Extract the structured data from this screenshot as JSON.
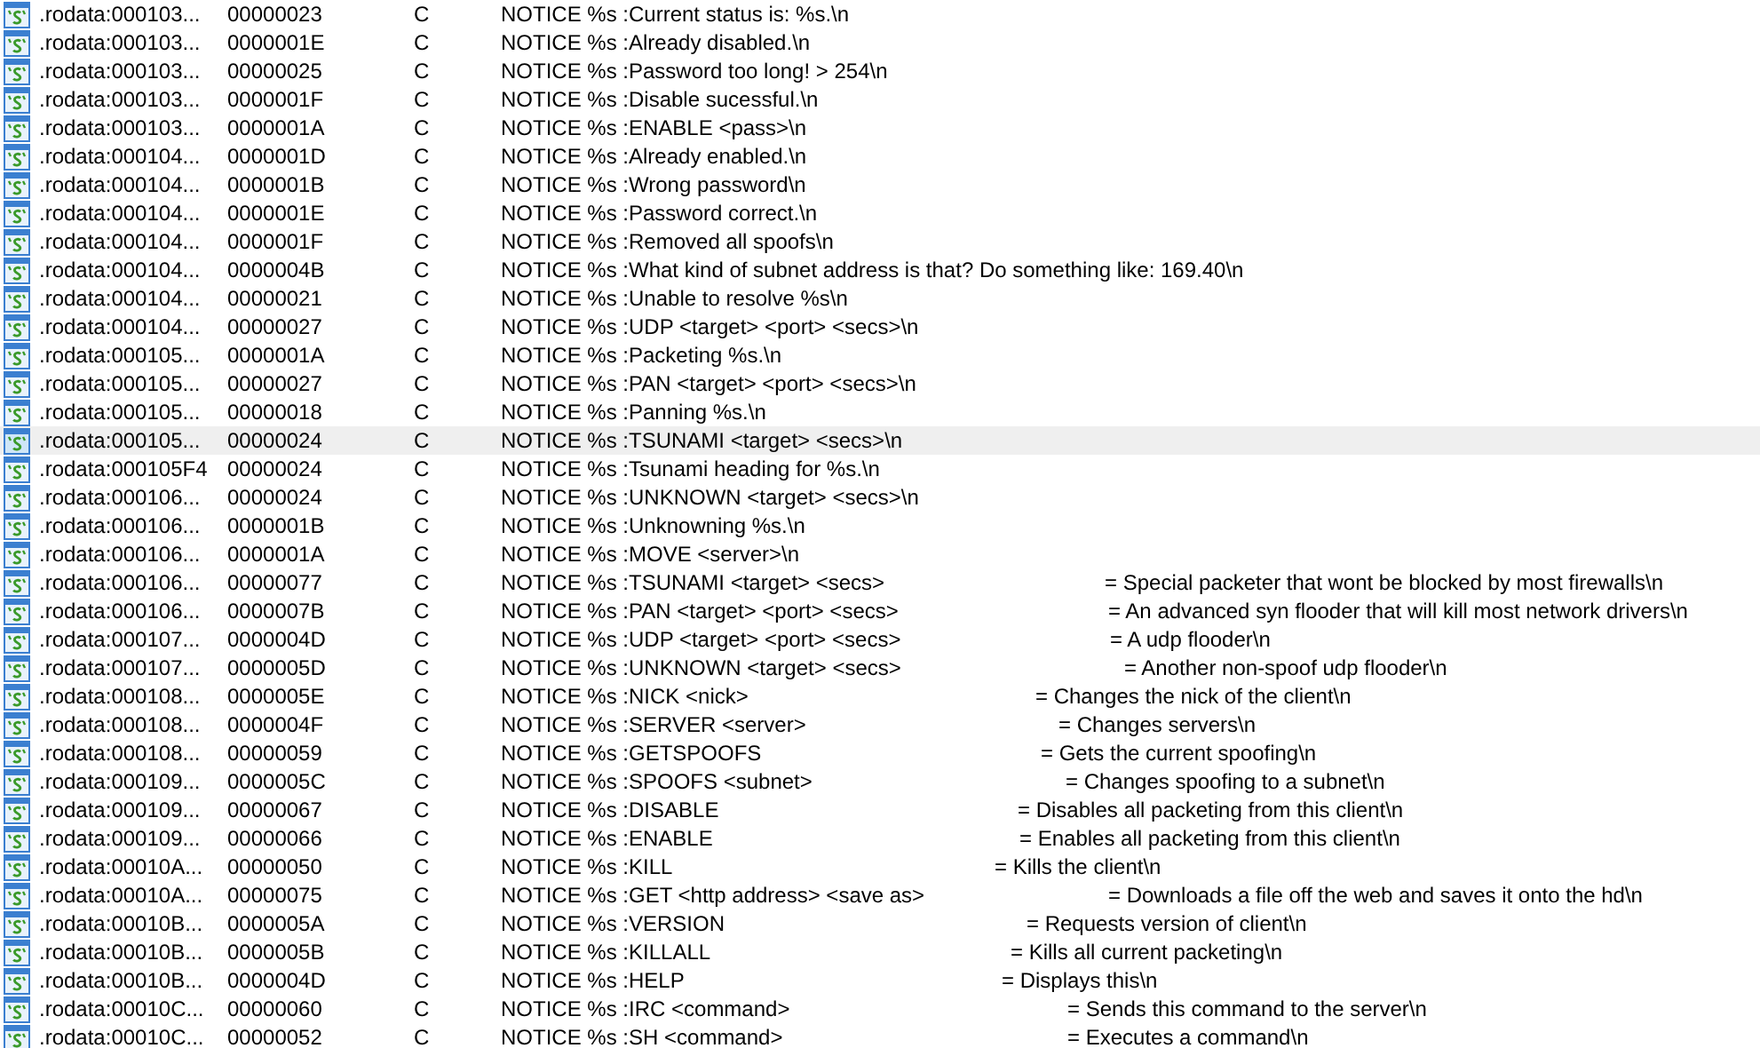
{
  "strings": [
    {
      "address": ".rodata:000103...",
      "length": "00000023",
      "type": "C",
      "string": "NOTICE %s :Current status is: %s.\\n",
      "selected": false
    },
    {
      "address": ".rodata:000103...",
      "length": "0000001E",
      "type": "C",
      "string": "NOTICE %s :Already disabled.\\n",
      "selected": false
    },
    {
      "address": ".rodata:000103...",
      "length": "00000025",
      "type": "C",
      "string": "NOTICE %s :Password too long! > 254\\n",
      "selected": false
    },
    {
      "address": ".rodata:000103...",
      "length": "0000001F",
      "type": "C",
      "string": "NOTICE %s :Disable sucessful.\\n",
      "selected": false
    },
    {
      "address": ".rodata:000103...",
      "length": "0000001A",
      "type": "C",
      "string": "NOTICE %s :ENABLE <pass>\\n",
      "selected": false
    },
    {
      "address": ".rodata:000104...",
      "length": "0000001D",
      "type": "C",
      "string": "NOTICE %s :Already enabled.\\n",
      "selected": false
    },
    {
      "address": ".rodata:000104...",
      "length": "0000001B",
      "type": "C",
      "string": "NOTICE %s :Wrong password\\n",
      "selected": false
    },
    {
      "address": ".rodata:000104...",
      "length": "0000001E",
      "type": "C",
      "string": "NOTICE %s :Password correct.\\n",
      "selected": false
    },
    {
      "address": ".rodata:000104...",
      "length": "0000001F",
      "type": "C",
      "string": "NOTICE %s :Removed all spoofs\\n",
      "selected": false
    },
    {
      "address": ".rodata:000104...",
      "length": "0000004B",
      "type": "C",
      "string": "NOTICE %s :What kind of subnet address is that? Do something like: 169.40\\n",
      "selected": false
    },
    {
      "address": ".rodata:000104...",
      "length": "00000021",
      "type": "C",
      "string": "NOTICE %s :Unable to resolve %s\\n",
      "selected": false
    },
    {
      "address": ".rodata:000104...",
      "length": "00000027",
      "type": "C",
      "string": "NOTICE %s :UDP <target> <port> <secs>\\n",
      "selected": false
    },
    {
      "address": ".rodata:000105...",
      "length": "0000001A",
      "type": "C",
      "string": "NOTICE %s :Packeting %s.\\n",
      "selected": false
    },
    {
      "address": ".rodata:000105...",
      "length": "00000027",
      "type": "C",
      "string": "NOTICE %s :PAN <target> <port> <secs>\\n",
      "selected": false
    },
    {
      "address": ".rodata:000105...",
      "length": "00000018",
      "type": "C",
      "string": "NOTICE %s :Panning %s.\\n",
      "selected": false
    },
    {
      "address": ".rodata:000105...",
      "length": "00000024",
      "type": "C",
      "string": "NOTICE %s :TSUNAMI <target> <secs>\\n",
      "selected": true
    },
    {
      "address": ".rodata:000105F4",
      "length": "00000024",
      "type": "C",
      "string": "NOTICE %s :Tsunami heading for %s.\\n",
      "selected": false
    },
    {
      "address": ".rodata:000106...",
      "length": "00000024",
      "type": "C",
      "string": "NOTICE %s :UNKNOWN <target> <secs>\\n",
      "selected": false
    },
    {
      "address": ".rodata:000106...",
      "length": "0000001B",
      "type": "C",
      "string": "NOTICE %s :Unknowning %s.\\n",
      "selected": false
    },
    {
      "address": ".rodata:000106...",
      "length": "0000001A",
      "type": "C",
      "string": "NOTICE %s :MOVE <server>\\n",
      "selected": false
    },
    {
      "address": ".rodata:000106...",
      "length": "00000077",
      "type": "C",
      "string": "NOTICE %s :TSUNAMI <target> <secs>",
      "help": "= Special packeter that wont be blocked by most firewalls\\n",
      "selected": false
    },
    {
      "address": ".rodata:000106...",
      "length": "0000007B",
      "type": "C",
      "string": "NOTICE %s :PAN <target> <port> <secs>",
      "help": "= An advanced syn flooder that will kill most network drivers\\n",
      "selected": false
    },
    {
      "address": ".rodata:000107...",
      "length": "0000004D",
      "type": "C",
      "string": "NOTICE %s :UDP <target> <port> <secs>",
      "help": "= A udp flooder\\n",
      "selected": false
    },
    {
      "address": ".rodata:000107...",
      "length": "0000005D",
      "type": "C",
      "string": "NOTICE %s :UNKNOWN <target> <secs>",
      "help": "= Another non-spoof udp flooder\\n",
      "selected": false
    },
    {
      "address": ".rodata:000108...",
      "length": "0000005E",
      "type": "C",
      "string": "NOTICE %s :NICK <nick>",
      "help": "= Changes the nick of the client\\n",
      "selected": false
    },
    {
      "address": ".rodata:000108...",
      "length": "0000004F",
      "type": "C",
      "string": "NOTICE %s :SERVER <server>",
      "help": "= Changes servers\\n",
      "selected": false
    },
    {
      "address": ".rodata:000108...",
      "length": "00000059",
      "type": "C",
      "string": "NOTICE %s :GETSPOOFS",
      "help": "= Gets the current spoofing\\n",
      "selected": false
    },
    {
      "address": ".rodata:000109...",
      "length": "0000005C",
      "type": "C",
      "string": "NOTICE %s :SPOOFS <subnet>",
      "help": "= Changes spoofing to a subnet\\n",
      "selected": false
    },
    {
      "address": ".rodata:000109...",
      "length": "00000067",
      "type": "C",
      "string": "NOTICE %s :DISABLE",
      "help": "= Disables all packeting from this client\\n",
      "selected": false
    },
    {
      "address": ".rodata:000109...",
      "length": "00000066",
      "type": "C",
      "string": "NOTICE %s :ENABLE",
      "help": "= Enables all packeting from this client\\n",
      "selected": false
    },
    {
      "address": ".rodata:00010A...",
      "length": "00000050",
      "type": "C",
      "string": "NOTICE %s :KILL",
      "help": "= Kills the client\\n",
      "selected": false
    },
    {
      "address": ".rodata:00010A...",
      "length": "00000075",
      "type": "C",
      "string": "NOTICE %s :GET <http address> <save as>",
      "help": "= Downloads a file off the web and saves it onto the hd\\n",
      "selected": false
    },
    {
      "address": ".rodata:00010B...",
      "length": "0000005A",
      "type": "C",
      "string": "NOTICE %s :VERSION",
      "help": "= Requests version of client\\n",
      "selected": false
    },
    {
      "address": ".rodata:00010B...",
      "length": "0000005B",
      "type": "C",
      "string": "NOTICE %s :KILLALL",
      "help": "= Kills all current packeting\\n",
      "selected": false
    },
    {
      "address": ".rodata:00010B...",
      "length": "0000004D",
      "type": "C",
      "string": "NOTICE %s :HELP",
      "help": "= Displays this\\n",
      "selected": false
    },
    {
      "address": ".rodata:00010C...",
      "length": "00000060",
      "type": "C",
      "string": "NOTICE %s :IRC <command>",
      "help": "= Sends this command to the server\\n",
      "selected": false
    },
    {
      "address": ".rodata:00010C...",
      "length": "00000052",
      "type": "C",
      "string": "NOTICE %s :SH <command>",
      "help": "= Executes a command\\n",
      "selected": false
    }
  ]
}
